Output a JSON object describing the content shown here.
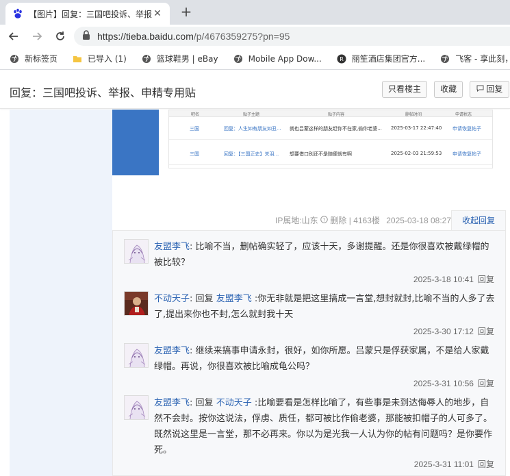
{
  "browser": {
    "tab_title": "【图片】回复：三国吧投诉、举报",
    "url_host": "https://tieba.baidu.com",
    "url_path": "/p/4676359275?pn=95",
    "bookmarks": [
      {
        "label": "新标签页",
        "icon": "globe-icon"
      },
      {
        "label": "已导入 (1)",
        "icon": "folder-icon"
      },
      {
        "label": "篮球鞋男 | eBay",
        "icon": "globe-icon"
      },
      {
        "label": "Mobile App Dow...",
        "icon": "globe-icon"
      },
      {
        "label": "丽笙酒店集团官方...",
        "icon": "hotel-icon"
      },
      {
        "label": "飞客 - 享此刻，享...",
        "icon": "globe-icon"
      }
    ]
  },
  "header": {
    "title": "回复：三国吧投诉、举报、申精专用贴",
    "only_op": "只看楼主",
    "favorite": "收藏",
    "reply": "回复"
  },
  "embed_table": {
    "headers": [
      "吧名",
      "贴子主题",
      "贴子内容",
      "删帖时间",
      "申请状态"
    ],
    "rows": [
      [
        "三国",
        "回复：人生如有朋友如丑...",
        "就也吕蒙这样的朋友赶你不在家,偷你老婆...",
        "2025-03-17 22:47:40",
        "申请恢复帖子"
      ],
      [
        "三国",
        "回复：【三国正史】关羽...",
        "想要借口别还不是随便就有啊",
        "2025-02-03 21:59:53",
        "申请恢复帖子"
      ]
    ]
  },
  "post_footer": {
    "ip_location": "IP属地:山东",
    "delete": "删除",
    "floor": "4163楼",
    "time": "2025-03-18 08:27",
    "collapse": "收起回复"
  },
  "replies": [
    {
      "user": "友盟李飞",
      "reply_to": "",
      "text": "比喻不当，删帖确实轻了，应该十天，多谢提醒。还是你很喜欢被戴绿帽的被比较？",
      "time": "2025-3-18 10:41",
      "action": "回复",
      "avatar": "anime-avatar"
    },
    {
      "user": "不动天子",
      "reply_to": "友盟李飞",
      "text": "你无非就是把这里搞成一言堂,想封就封,比喻不当的人多了去了,提出来你也不封,怎么就封我十天",
      "time": "2025-3-30 17:12",
      "action": "回复",
      "avatar": "portrait-avatar"
    },
    {
      "user": "友盟李飞",
      "reply_to": "",
      "text": "继续来搞事申请永封，很好，如你所愿。吕蒙只是俘获家属，不是给人家戴绿帽。再说，你很喜欢被比喻成龟公吗？",
      "time": "2025-3-31 10:56",
      "action": "回复",
      "avatar": "anime-avatar"
    },
    {
      "user": "友盟李飞",
      "reply_to": "不动天子",
      "text": "比喻要看是怎样比喻了，有些事是未到达侮辱人的地步，自然不会封。按你这说法，俘虏、质任，都可被比作偷老婆，那能被扣帽子的人可多了。既然说这里是一言堂，那不必再来。你以为是光我一人认为你的帖有问题吗？是你要作死。",
      "time": "2025-3-31 11:01",
      "action": "回复",
      "avatar": "anime-avatar"
    }
  ],
  "labels": {
    "reply_word": "回复",
    "colon": ":"
  }
}
